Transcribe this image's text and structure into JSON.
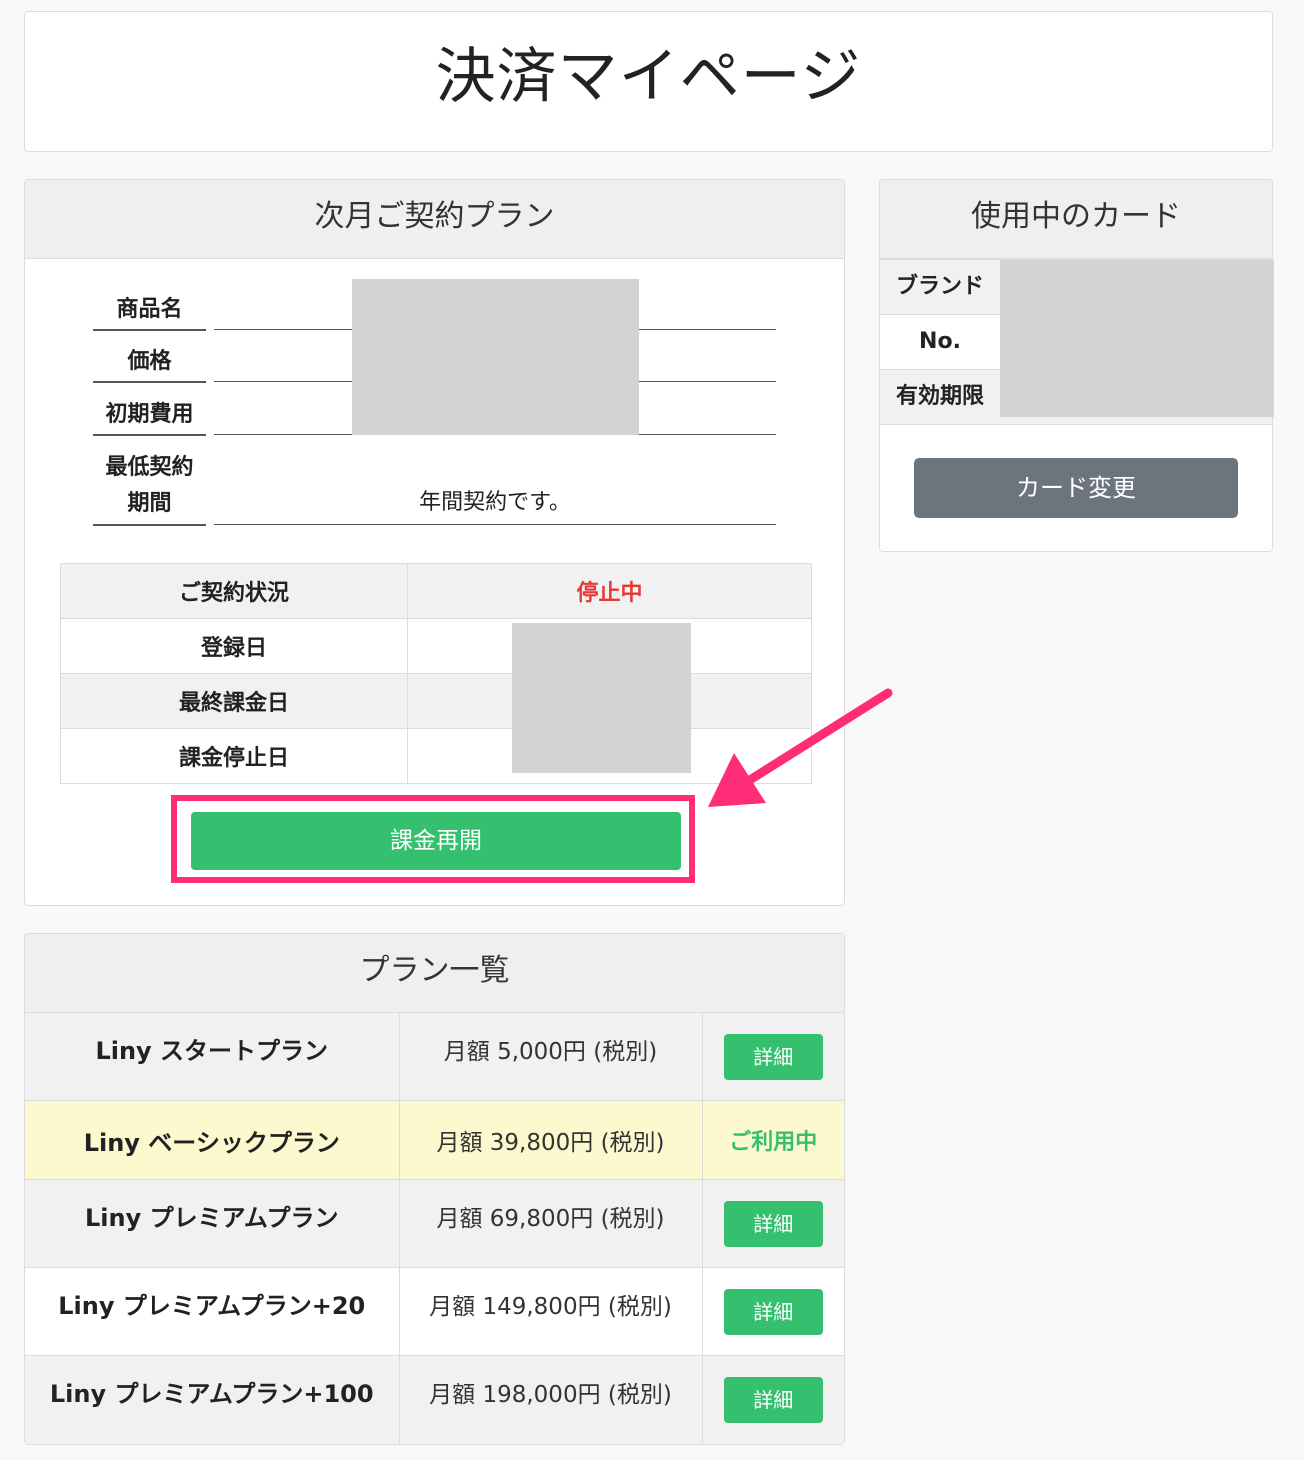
{
  "header": {
    "title": "決済マイページ"
  },
  "next_plan": {
    "heading": "次月ご契約プラン",
    "fields": [
      {
        "label": "商品名",
        "value": ""
      },
      {
        "label": "価格",
        "value": ""
      },
      {
        "label": "初期費用",
        "value": ""
      },
      {
        "label": "最低契約期間",
        "label_line1": "最低契約",
        "label_line2": "期間",
        "value": "年間契約です。"
      }
    ],
    "status_rows": [
      {
        "label": "ご契約状況",
        "value": "停止中"
      },
      {
        "label": "登録日",
        "value": ""
      },
      {
        "label": "最終課金日",
        "value": ""
      },
      {
        "label": "課金停止日",
        "value": ""
      }
    ],
    "resume_button_label": "課金再開"
  },
  "card_in_use": {
    "heading": "使用中のカード",
    "rows": [
      {
        "label": "ブランド"
      },
      {
        "label": "No."
      },
      {
        "label": "有効期限"
      }
    ],
    "change_button_label": "カード変更"
  },
  "plan_list": {
    "heading": "プラン一覧",
    "plans": [
      {
        "name": "Liny スタートプラン",
        "price": "月額 5,000円 (税別)",
        "action": "詳細"
      },
      {
        "name": "Liny ベーシックプラン",
        "price": "月額 39,800円 (税別)",
        "action": "ご利用中"
      },
      {
        "name": "Liny プレミアムプラン",
        "price": "月額 69,800円 (税別)",
        "action": "詳細"
      },
      {
        "name": "Liny プレミアムプラン+20",
        "price": "月額 149,800円 (税別)",
        "action": "詳細"
      },
      {
        "name": "Liny プレミアムプラン+100",
        "price": "月額 198,000円 (税別)",
        "action": "詳細"
      }
    ]
  },
  "colors": {
    "accent_green": "#35c070",
    "status_red": "#e53935",
    "highlight_pink": "#ff2d78",
    "current_row_yellow": "#fdf9cf",
    "secondary_gray": "#6c757d"
  }
}
